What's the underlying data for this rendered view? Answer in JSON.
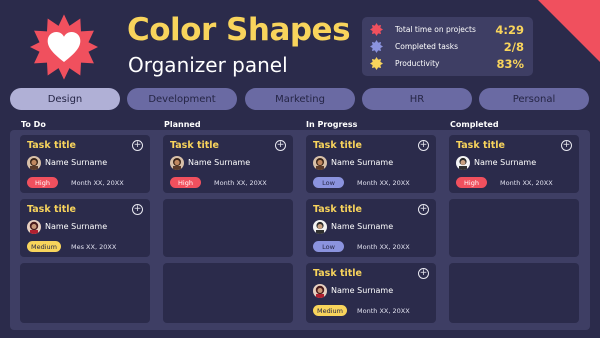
{
  "header": {
    "title": "Color Shapes",
    "subtitle": "Organizer panel"
  },
  "colors": {
    "background": "#2b2b4b",
    "panel": "#3e3e64",
    "accent_yellow": "#f8d45c",
    "accent_red": "#f0505e",
    "accent_blue": "#8b93de"
  },
  "stats": [
    {
      "label": "Total time on projects",
      "value": "4:29",
      "icon": "red-star-icon"
    },
    {
      "label": "Completed tasks",
      "value": "2/8",
      "icon": "blue-star-icon"
    },
    {
      "label": "Productivity",
      "value": "83%",
      "icon": "yellow-star-icon"
    }
  ],
  "tabs": [
    "Design",
    "Development",
    "Marketing",
    "HR",
    "Personal"
  ],
  "columns": [
    {
      "label": "To Do",
      "cards": [
        {
          "title": "Task title",
          "name": "Name Surname",
          "priority": "High",
          "date": "Month XX, 20XX"
        },
        {
          "title": "Task title",
          "name": "Name Surname",
          "priority": "Medium",
          "date": "Mes XX, 20XX"
        }
      ]
    },
    {
      "label": "Planned",
      "cards": [
        {
          "title": "Task title",
          "name": "Name Surname",
          "priority": "High",
          "date": "Month XX, 20XX"
        }
      ]
    },
    {
      "label": "In Progress",
      "cards": [
        {
          "title": "Task title",
          "name": "Name Surname",
          "priority": "Low",
          "date": "Month XX, 20XX"
        },
        {
          "title": "Task title",
          "name": "Name Surname",
          "priority": "Low",
          "date": "Month XX, 20XX"
        },
        {
          "title": "Task title",
          "name": "Name Surname",
          "priority": "Medium",
          "date": "Month XX, 20XX"
        }
      ]
    },
    {
      "label": "Completed",
      "cards": [
        {
          "title": "Task title",
          "name": "Name Surname",
          "priority": "High",
          "date": "Month XX, 20XX"
        }
      ]
    }
  ],
  "plus_glyph": "+"
}
